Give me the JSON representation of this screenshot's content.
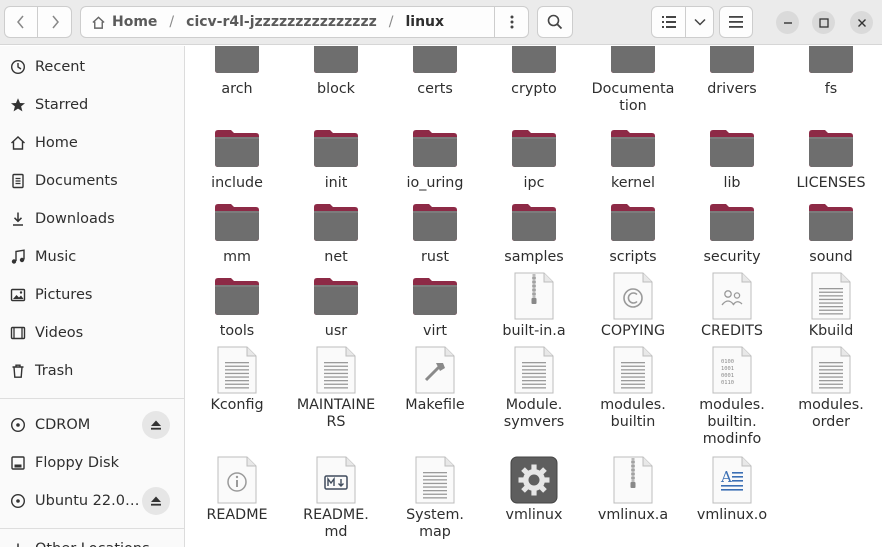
{
  "header": {
    "path": {
      "home_label": "Home",
      "folder_label": "cicv-r4l-jzzzzzzzzzzzzzzz",
      "current_label": "linux",
      "separator": "/"
    }
  },
  "sidebar": {
    "places": [
      {
        "label": "Recent",
        "icon": "clock-icon"
      },
      {
        "label": "Starred",
        "icon": "star-icon"
      },
      {
        "label": "Home",
        "icon": "home-icon"
      },
      {
        "label": "Documents",
        "icon": "document-icon"
      },
      {
        "label": "Downloads",
        "icon": "download-icon"
      },
      {
        "label": "Music",
        "icon": "music-icon"
      },
      {
        "label": "Pictures",
        "icon": "picture-icon"
      },
      {
        "label": "Videos",
        "icon": "video-icon"
      },
      {
        "label": "Trash",
        "icon": "trash-icon"
      }
    ],
    "devices": [
      {
        "label": "CDROM",
        "icon": "disc-icon",
        "eject": true
      },
      {
        "label": "Floppy Disk",
        "icon": "drive-icon",
        "eject": false
      },
      {
        "label": "Ubuntu 22.0…",
        "icon": "disc-icon",
        "eject": true
      }
    ],
    "other": {
      "label": "Other Locations",
      "icon": "plus-icon"
    }
  },
  "files": [
    {
      "name": "arch",
      "type": "folder"
    },
    {
      "name": "block",
      "type": "folder"
    },
    {
      "name": "certs",
      "type": "folder"
    },
    {
      "name": "crypto",
      "type": "folder"
    },
    {
      "name": "Documenta\ntion",
      "type": "folder"
    },
    {
      "name": "drivers",
      "type": "folder"
    },
    {
      "name": "fs",
      "type": "folder"
    },
    {
      "name": "include",
      "type": "folder"
    },
    {
      "name": "init",
      "type": "folder"
    },
    {
      "name": "io_uring",
      "type": "folder"
    },
    {
      "name": "ipc",
      "type": "folder"
    },
    {
      "name": "kernel",
      "type": "folder"
    },
    {
      "name": "lib",
      "type": "folder"
    },
    {
      "name": "LICENSES",
      "type": "folder"
    },
    {
      "name": "mm",
      "type": "folder"
    },
    {
      "name": "net",
      "type": "folder"
    },
    {
      "name": "rust",
      "type": "folder"
    },
    {
      "name": "samples",
      "type": "folder"
    },
    {
      "name": "scripts",
      "type": "folder"
    },
    {
      "name": "security",
      "type": "folder"
    },
    {
      "name": "sound",
      "type": "folder"
    },
    {
      "name": "tools",
      "type": "folder"
    },
    {
      "name": "usr",
      "type": "folder"
    },
    {
      "name": "virt",
      "type": "folder"
    },
    {
      "name": "built-in.a",
      "type": "archive"
    },
    {
      "name": "COPYING",
      "type": "copyright"
    },
    {
      "name": "CREDITS",
      "type": "credits"
    },
    {
      "name": "Kbuild",
      "type": "text"
    },
    {
      "name": "Kconfig",
      "type": "text"
    },
    {
      "name": "MAINTAINE\nRS",
      "type": "text"
    },
    {
      "name": "Makefile",
      "type": "makefile"
    },
    {
      "name": "Module.\nsymvers",
      "type": "text"
    },
    {
      "name": "modules.\nbuiltin",
      "type": "text"
    },
    {
      "name": "modules.\nbuiltin.\nmodinfo",
      "type": "binary"
    },
    {
      "name": "modules.\norder",
      "type": "text"
    },
    {
      "name": "README",
      "type": "readme"
    },
    {
      "name": "README.\nmd",
      "type": "markdown"
    },
    {
      "name": "System.\nmap",
      "type": "text"
    },
    {
      "name": "vmlinux",
      "type": "executable"
    },
    {
      "name": "vmlinux.a",
      "type": "archive"
    },
    {
      "name": "vmlinux.o",
      "type": "object"
    }
  ]
}
